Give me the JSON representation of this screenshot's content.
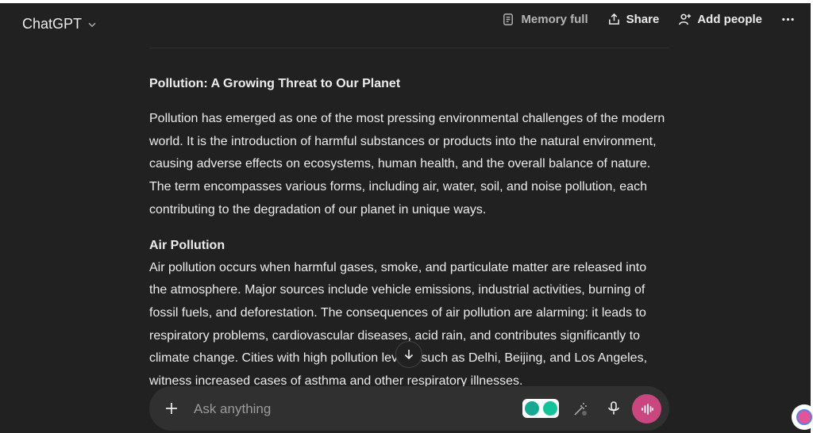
{
  "header": {
    "model_name": "ChatGPT",
    "memory_label": "Memory full",
    "share_label": "Share",
    "add_people_label": "Add people"
  },
  "message": {
    "title": "Pollution: A Growing Threat to Our Planet",
    "intro": "Pollution has emerged as one of the most pressing environmental challenges of the modern world. It is the introduction of harmful substances or products into the natural environment, causing adverse effects on ecosystems, human health, and the overall balance of nature. The term encompasses various forms, including air, water, soil, and noise pollution, each contributing to the degradation of our planet in unique ways.",
    "section_heading": "Air Pollution",
    "section_body": "Air pollution occurs when harmful gases, smoke, and particulate matter are released into the atmosphere. Major sources include vehicle emissions, industrial activities, burning of fossil fuels, and deforestation. The consequences of air pollution are alarming: it leads to respiratory problems, cardiovascular diseases, acid rain, and contributes significantly to climate change. Cities with high pollution levels, such as Delhi, Beijing, and Los Angeles, witness increased cases of asthma and other respiratory illnesses."
  },
  "composer": {
    "placeholder": "Ask anything"
  },
  "icons": {
    "model_dropdown": "chevron-down-icon",
    "memory": "memory-icon",
    "share": "share-icon",
    "add_people": "add-person-icon",
    "more": "more-options-icon",
    "scroll": "arrow-down-icon",
    "plus": "plus-icon",
    "tools": "magic-wand-icon",
    "mic": "microphone-icon",
    "voice": "voice-waveform-icon"
  },
  "colors": {
    "background": "#212121",
    "composer_bg": "#303030",
    "voice_button": "#c9467e",
    "text": "#ececec"
  }
}
